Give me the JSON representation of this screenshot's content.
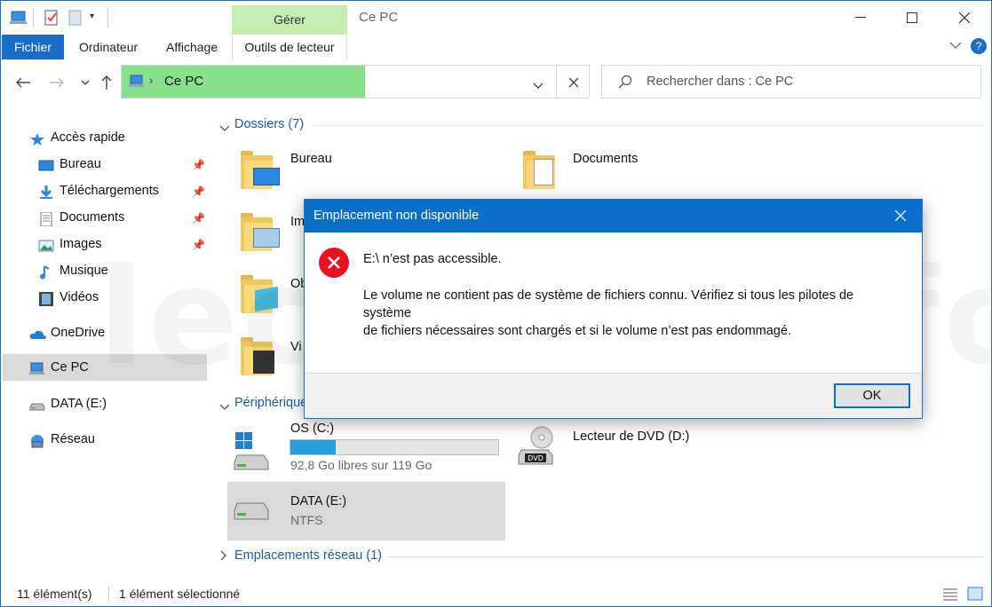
{
  "titlebar": {
    "context_tab": "Gérer",
    "title": "Ce PC"
  },
  "ribbon": {
    "tabs": [
      "Fichier",
      "Ordinateur",
      "Affichage",
      "Outils de lecteur"
    ]
  },
  "address": {
    "crumb": "Ce PC",
    "search_placeholder": "Rechercher dans : Ce PC"
  },
  "nav": {
    "quick_access": "Accès rapide",
    "items": [
      "Bureau",
      "Téléchargements",
      "Documents",
      "Images",
      "Musique",
      "Vidéos"
    ],
    "onedrive": "OneDrive",
    "thispc": "Ce PC",
    "data_drive": "DATA (E:)",
    "network": "Réseau"
  },
  "content": {
    "folders_header": "Dossiers (7)",
    "folders": [
      "Bureau",
      "Documents",
      "Im",
      "Ob",
      "Vi"
    ],
    "devices_header": "Périphérique",
    "drives": [
      {
        "label": "OS (C:)",
        "sub": "92,8 Go libres sur 119 Go",
        "used_fraction": 0.22
      },
      {
        "label": "Lecteur de DVD (D:)",
        "sub": ""
      },
      {
        "label": "DATA (E:)",
        "sub": "NTFS"
      }
    ],
    "network_header": "Emplacements réseau (1)"
  },
  "status": {
    "count": "11 élément(s)",
    "selected": "1 élément sélectionné"
  },
  "watermark": "lecrabe.info",
  "dialog": {
    "title": "Emplacement non disponible",
    "message1": "E:\\ n’est pas accessible.",
    "message2_line1": "Le volume ne contient pas de système de fichiers connu. Vérifiez si tous les pilotes de système",
    "message2_line2": "de fichiers nécessaires sont chargés et si le volume n’est pas endommagé.",
    "ok": "OK"
  },
  "colors": {
    "accent": "#0a6fc9",
    "address_highlight": "#87e08c",
    "context_tab": "#c7ecb0",
    "error": "#e81123",
    "progress": "#26a0da"
  }
}
